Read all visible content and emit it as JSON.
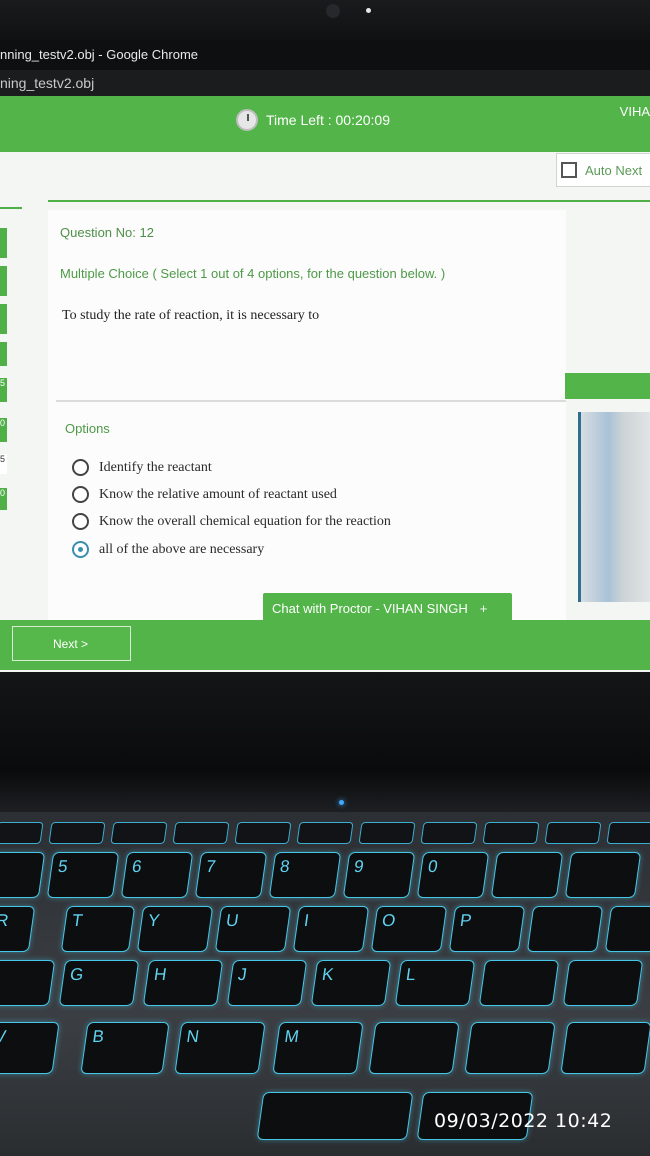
{
  "browser": {
    "title": "nning_testv2.obj - Google Chrome",
    "address": "ning_testv2.obj"
  },
  "exam": {
    "timer_label": "Time Left : 00:20:09",
    "user_name": "VIHA",
    "auto_next_label": "Auto Next",
    "side_tab_numbers": [
      "5",
      "0",
      "5",
      "0"
    ],
    "question_number": "Question No: 12",
    "question_type": "Multiple Choice ( Select 1 out of 4 options, for the question below. )",
    "question_text": "To study the rate of reaction, it is necessary to",
    "options_label": "Options",
    "options": [
      {
        "text": "Identify the reactant",
        "selected": false
      },
      {
        "text": "Know the relative amount of reactant used",
        "selected": false
      },
      {
        "text": "Know the overall chemical equation for the reaction",
        "selected": false
      },
      {
        "text": "all of the above are necessary",
        "selected": true
      }
    ],
    "chat_label": "Chat with Proctor - VIHAN SINGH",
    "chat_plus": "+",
    "next_label": "Next >"
  },
  "colors": {
    "accent_green": "#53b549",
    "selected_radio": "#3a8fb0",
    "key_backlight": "#46c7e8"
  },
  "keyboard": {
    "number_row": [
      "5",
      "6",
      "7",
      "8",
      "9",
      "0"
    ],
    "top_row": [
      "R",
      "T",
      "Y",
      "U",
      "I",
      "O",
      "P"
    ],
    "home_row": [
      "G",
      "H",
      "J",
      "K",
      "L"
    ],
    "bottom_row": [
      "V",
      "B",
      "N",
      "M"
    ]
  },
  "photo_timestamp": "09/03/2022 10:42"
}
